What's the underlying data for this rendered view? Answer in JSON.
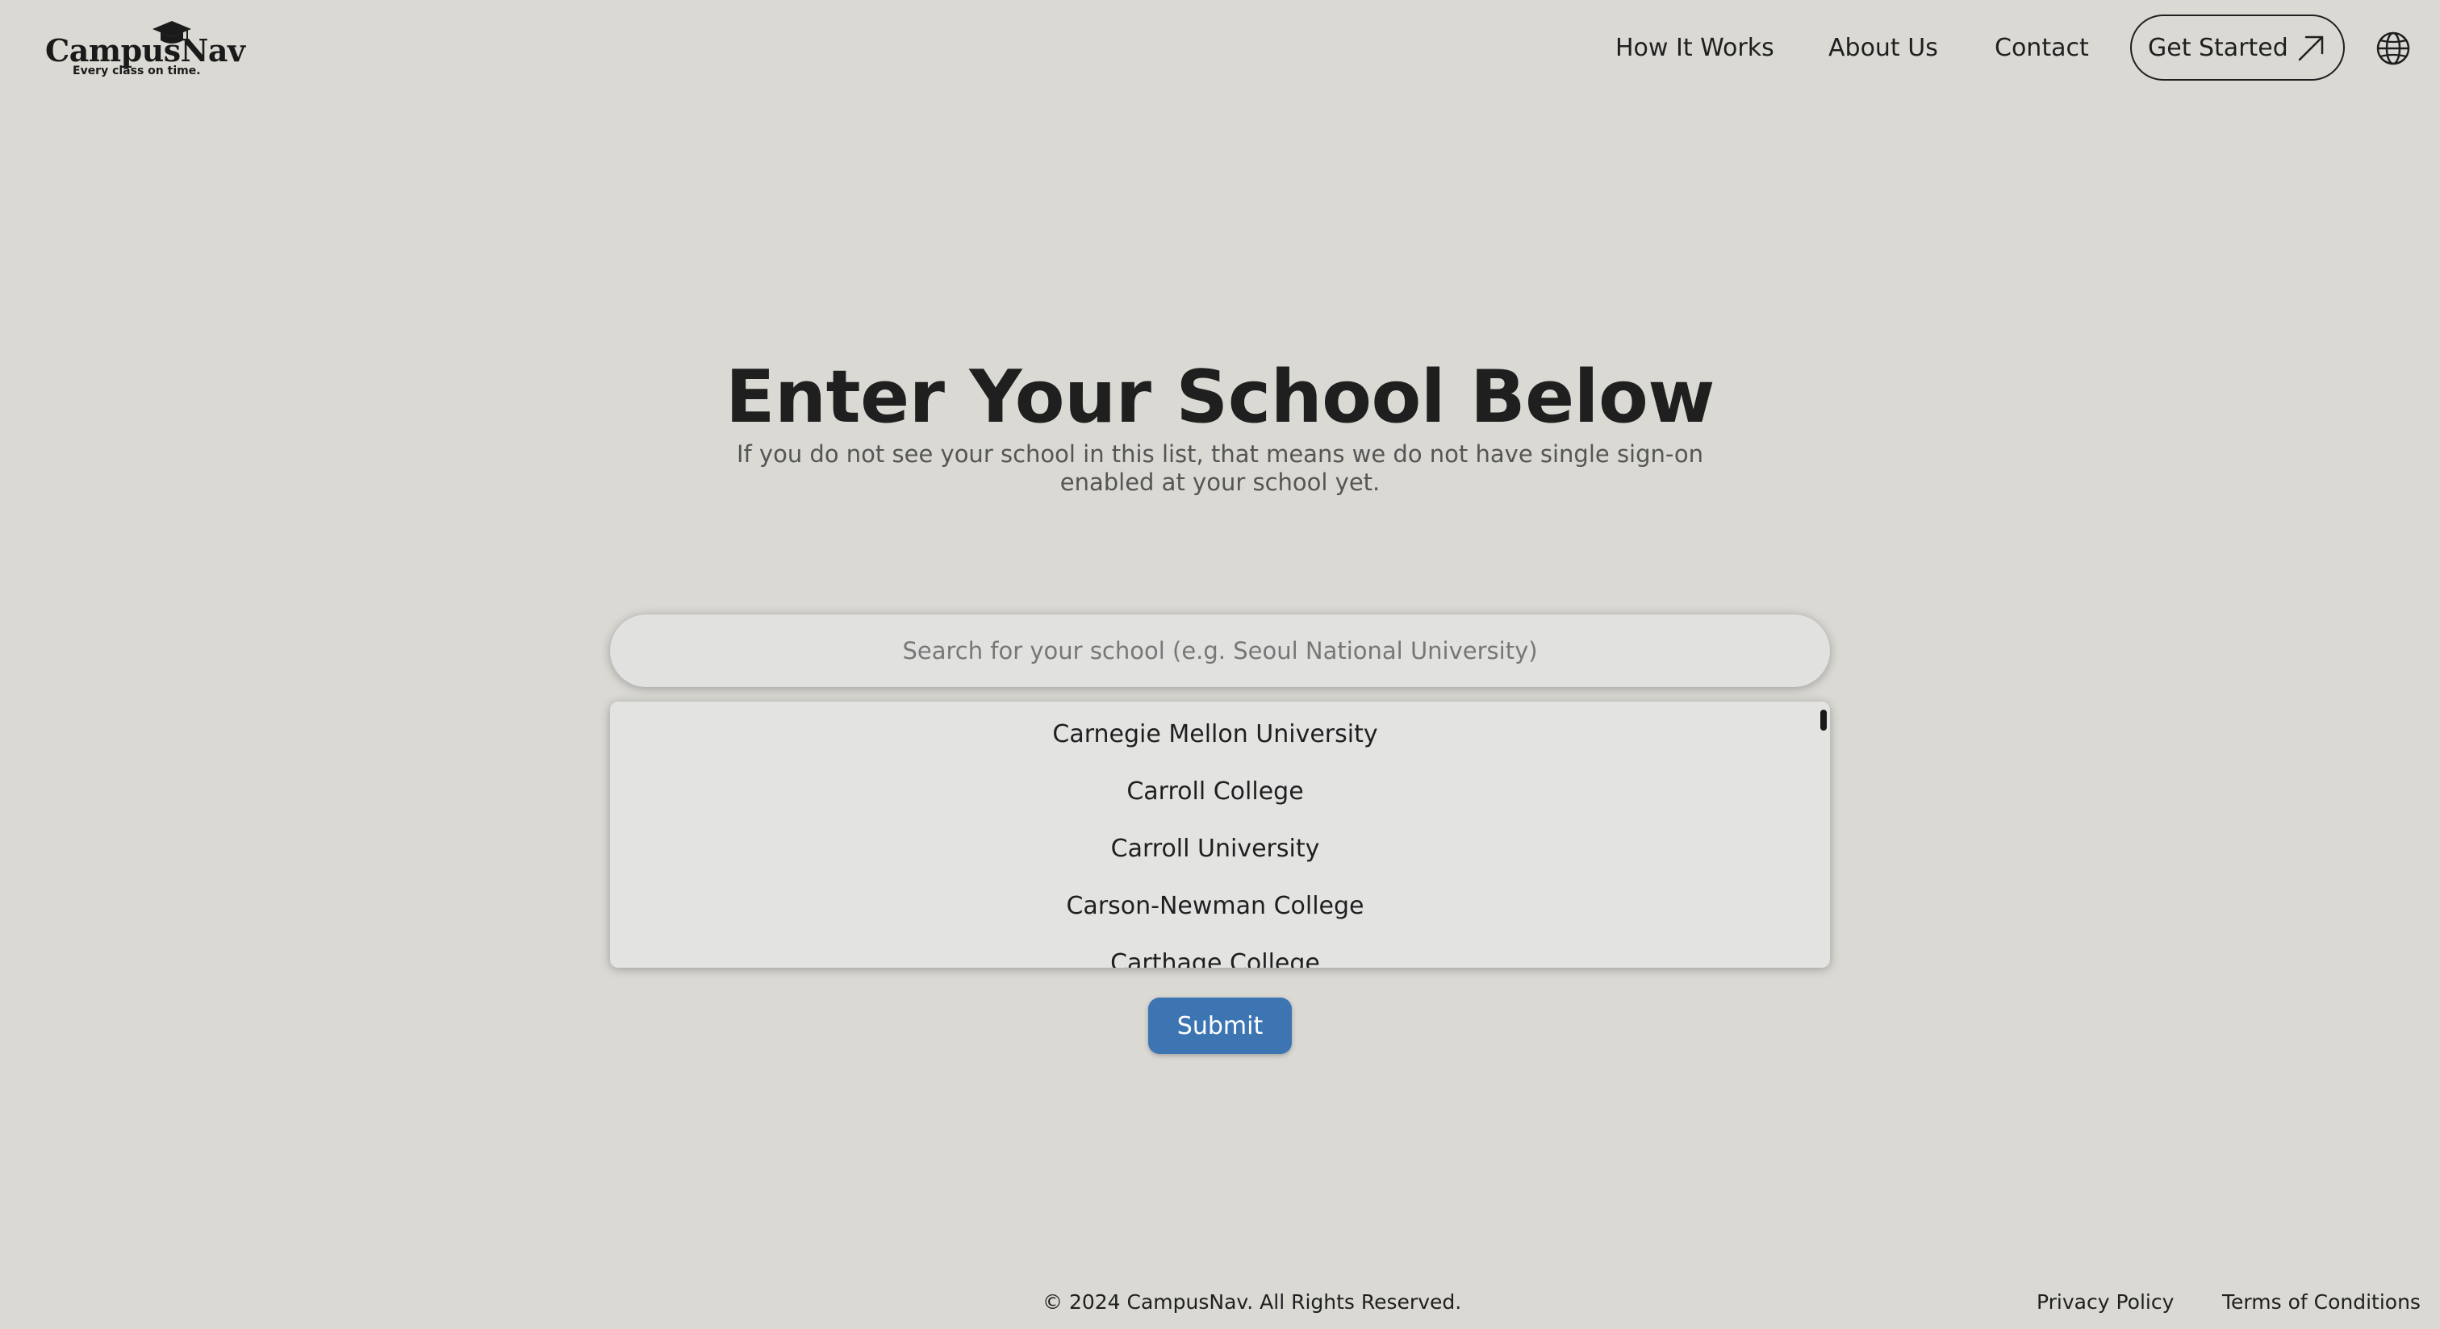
{
  "brand": {
    "name": "CampusNav",
    "tagline": "Every class on time.",
    "logo_icon": "graduation-cap-icon"
  },
  "nav": {
    "links": [
      "How It Works",
      "About Us",
      "Contact"
    ],
    "cta_label": "Get Started",
    "cta_icon": "arrow-up-right-icon",
    "language_icon": "globe-icon"
  },
  "hero": {
    "title": "Enter Your School Below",
    "subtitle": "If you do not see your school in this list, that means we do not have single sign-on enabled at your school yet."
  },
  "search": {
    "placeholder": "Search for your school (e.g. Seoul National University)",
    "value": "",
    "results": [
      "Carnegie Mellon University",
      "Carroll College",
      "Carroll University",
      "Carson-Newman College",
      "Carthage College"
    ]
  },
  "submit_label": "Submit",
  "footer": {
    "copyright": "© 2024 CampusNav. All Rights Reserved.",
    "links": [
      "Privacy Policy",
      "Terms of Conditions"
    ]
  },
  "colors": {
    "background": "#dad9d4",
    "primary_button": "#3d75b2",
    "text": "#1f1f1f",
    "muted_text": "#555555"
  }
}
